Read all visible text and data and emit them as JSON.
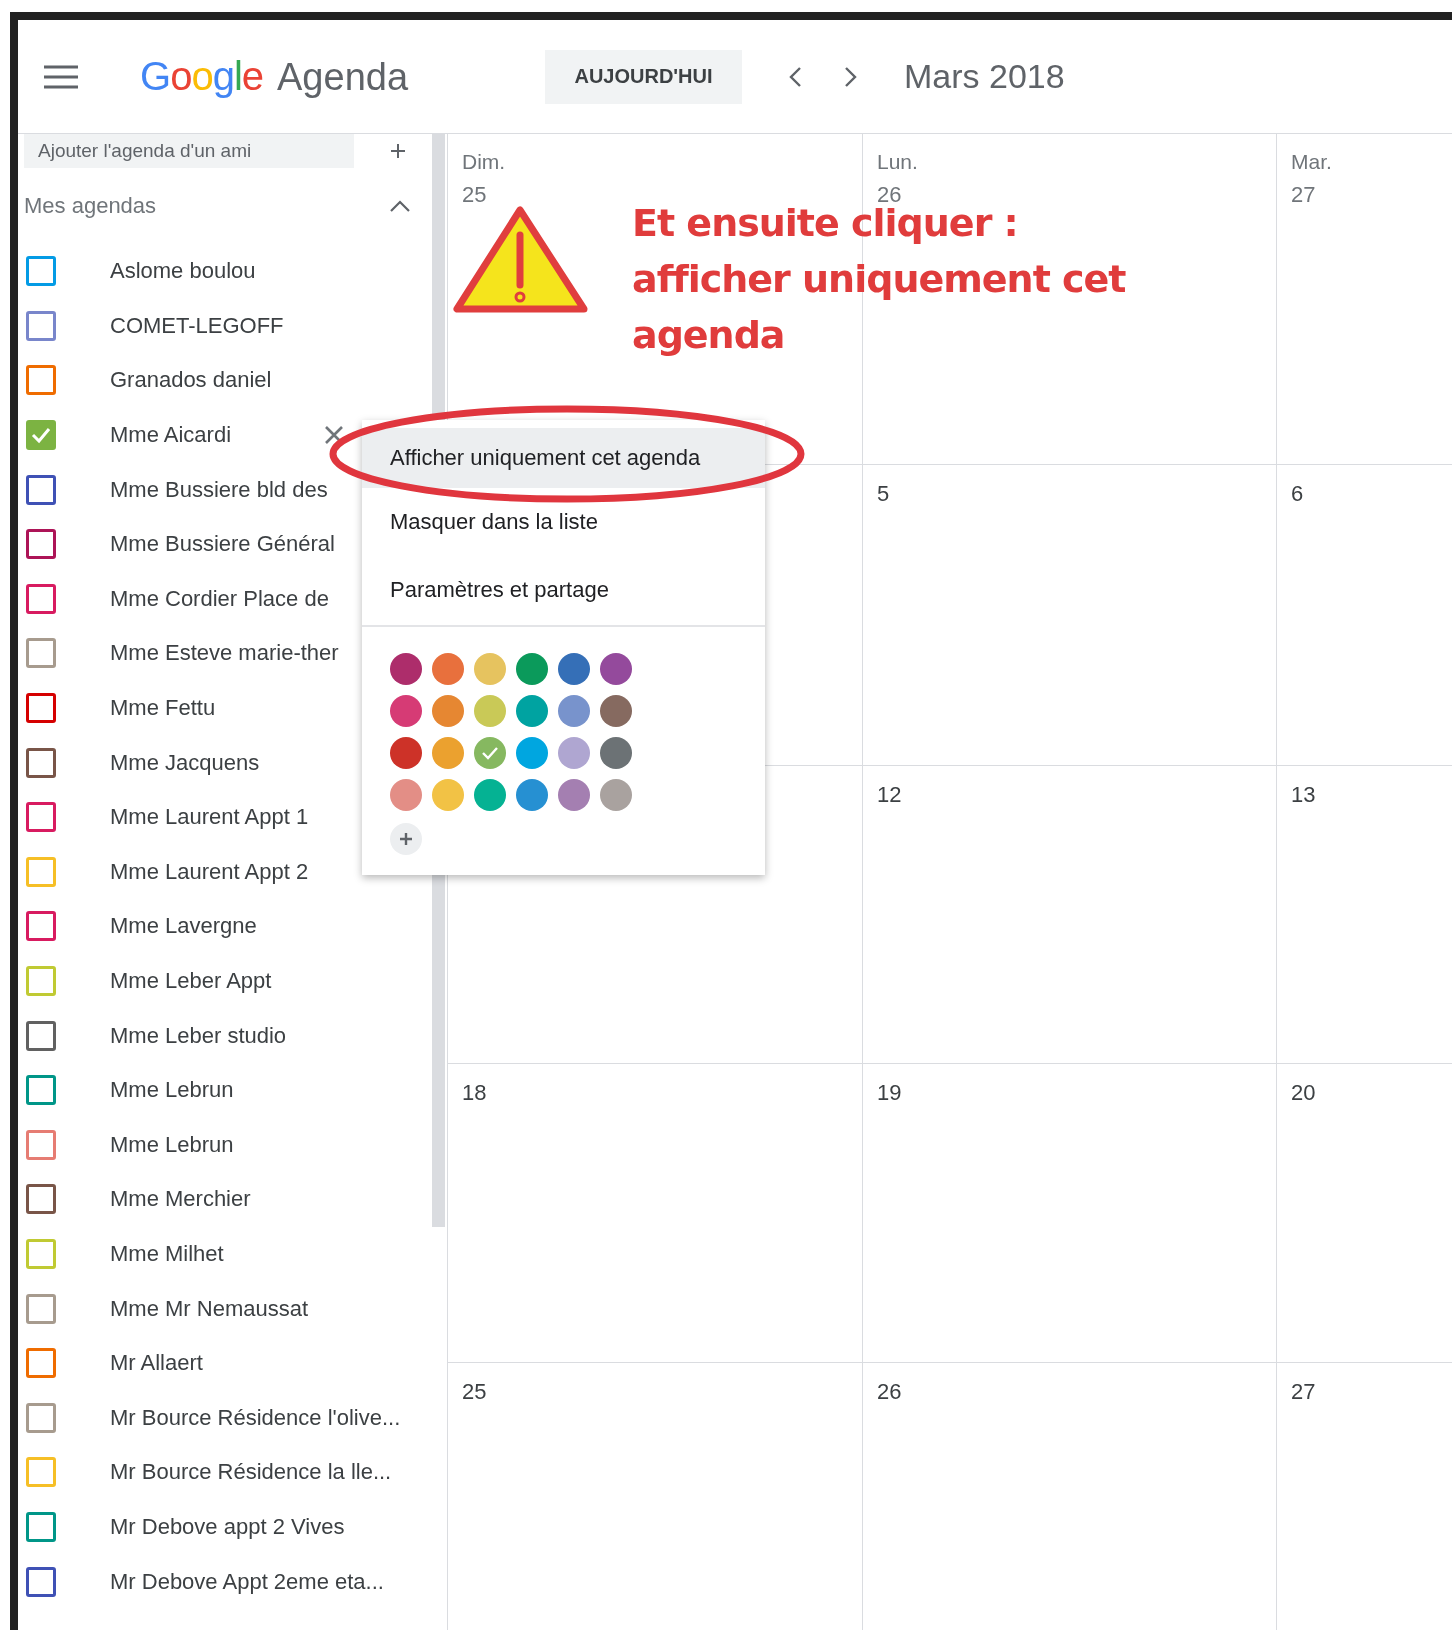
{
  "header": {
    "brand": "Google",
    "product": "Agenda",
    "today_button": "AUJOURD'HUI",
    "period": "Mars 2018"
  },
  "sidebar": {
    "add_field": {
      "placeholder": "Ajouter l'agenda d'un ami"
    },
    "section": {
      "title": "Mes agendas",
      "expanded": true
    },
    "calendars": [
      {
        "name": "Aslome boulou",
        "color": "#039be5",
        "checked": false,
        "hovered": false
      },
      {
        "name": "COMET-LEGOFF",
        "color": "#7986cb",
        "checked": false,
        "hovered": false
      },
      {
        "name": "Granados daniel",
        "color": "#ef6c00",
        "checked": false,
        "hovered": false
      },
      {
        "name": "Mme Aicardi",
        "color": "#7cb342",
        "checked": true,
        "hovered": true
      },
      {
        "name": "Mme Bussiere bld des",
        "color": "#3f51b5",
        "checked": false,
        "hovered": false
      },
      {
        "name": "Mme Bussiere Général",
        "color": "#ad1457",
        "checked": false,
        "hovered": false
      },
      {
        "name": "Mme Cordier Place de",
        "color": "#d81b60",
        "checked": false,
        "hovered": false
      },
      {
        "name": "Mme Esteve marie-ther",
        "color": "#a79b8e",
        "checked": false,
        "hovered": false
      },
      {
        "name": "Mme Fettu",
        "color": "#d50000",
        "checked": false,
        "hovered": false
      },
      {
        "name": "Mme Jacquens",
        "color": "#795548",
        "checked": false,
        "hovered": false
      },
      {
        "name": "Mme Laurent Appt 1",
        "color": "#d81b60",
        "checked": false,
        "hovered": false
      },
      {
        "name": "Mme Laurent Appt 2",
        "color": "#f6bf26",
        "checked": false,
        "hovered": false
      },
      {
        "name": "Mme Lavergne",
        "color": "#d81b60",
        "checked": false,
        "hovered": false
      },
      {
        "name": "Mme Leber Appt",
        "color": "#c0ca33",
        "checked": false,
        "hovered": false
      },
      {
        "name": "Mme Leber studio",
        "color": "#616161",
        "checked": false,
        "hovered": false
      },
      {
        "name": "Mme Lebrun",
        "color": "#009688",
        "checked": false,
        "hovered": false
      },
      {
        "name": "Mme Lebrun",
        "color": "#e67c73",
        "checked": false,
        "hovered": false
      },
      {
        "name": "Mme Merchier",
        "color": "#795548",
        "checked": false,
        "hovered": false
      },
      {
        "name": "Mme Milhet",
        "color": "#c0ca33",
        "checked": false,
        "hovered": false
      },
      {
        "name": "Mme Mr Nemaussat",
        "color": "#a79b8e",
        "checked": false,
        "hovered": false
      },
      {
        "name": "Mr Allaert",
        "color": "#ef6c00",
        "checked": false,
        "hovered": false
      },
      {
        "name": "Mr Bource Résidence l'olive...",
        "color": "#a79b8e",
        "checked": false,
        "hovered": false
      },
      {
        "name": "Mr Bource Résidence la lle...",
        "color": "#f6bf26",
        "checked": false,
        "hovered": false
      },
      {
        "name": "Mr Debove appt 2 Vives",
        "color": "#009688",
        "checked": false,
        "hovered": false
      },
      {
        "name": "Mr Debove Appt 2eme eta...",
        "color": "#3f51b5",
        "checked": false,
        "hovered": false
      }
    ]
  },
  "calendar": {
    "columns": [
      {
        "weekday": "Dim.",
        "day": "25"
      },
      {
        "weekday": "Lun.",
        "day": "26"
      },
      {
        "weekday": "Mar.",
        "day": "27"
      }
    ],
    "weeks": [
      [
        "5",
        "6"
      ],
      [
        "12",
        "13"
      ],
      [
        "18",
        "19",
        "20"
      ],
      [
        "25",
        "26",
        "27"
      ]
    ]
  },
  "context_menu": {
    "items": [
      {
        "label": "Afficher uniquement cet agenda",
        "selected": true
      },
      {
        "label": "Masquer dans la liste",
        "selected": false
      },
      {
        "label": "Paramètres et partage",
        "selected": false
      }
    ],
    "colors": [
      {
        "color": "#ad2d6b",
        "selected": false
      },
      {
        "color": "#e8703d",
        "selected": false
      },
      {
        "color": "#e6c35f",
        "selected": false
      },
      {
        "color": "#0b9a5b",
        "selected": false
      },
      {
        "color": "#356fb7",
        "selected": false
      },
      {
        "color": "#944a9c",
        "selected": false
      },
      {
        "color": "#d63b75",
        "selected": false
      },
      {
        "color": "#e68732",
        "selected": false
      },
      {
        "color": "#c9c957",
        "selected": false
      },
      {
        "color": "#00a3a1",
        "selected": false
      },
      {
        "color": "#7893cc",
        "selected": false
      },
      {
        "color": "#866a60",
        "selected": false
      },
      {
        "color": "#cd3228",
        "selected": false
      },
      {
        "color": "#eba12f",
        "selected": false
      },
      {
        "color": "#86b860",
        "selected": true
      },
      {
        "color": "#00a6e0",
        "selected": false
      },
      {
        "color": "#afa6d1",
        "selected": false
      },
      {
        "color": "#6c7275",
        "selected": false
      },
      {
        "color": "#e38e86",
        "selected": false
      },
      {
        "color": "#f2c245",
        "selected": false
      },
      {
        "color": "#05b293",
        "selected": false
      },
      {
        "color": "#2690d2",
        "selected": false
      },
      {
        "color": "#a47fb1",
        "selected": false
      },
      {
        "color": "#a9a29f",
        "selected": false
      }
    ]
  },
  "annotation": {
    "lines": [
      "Et ensuite cliquer :",
      "afficher uniquement cet",
      "agenda"
    ]
  }
}
